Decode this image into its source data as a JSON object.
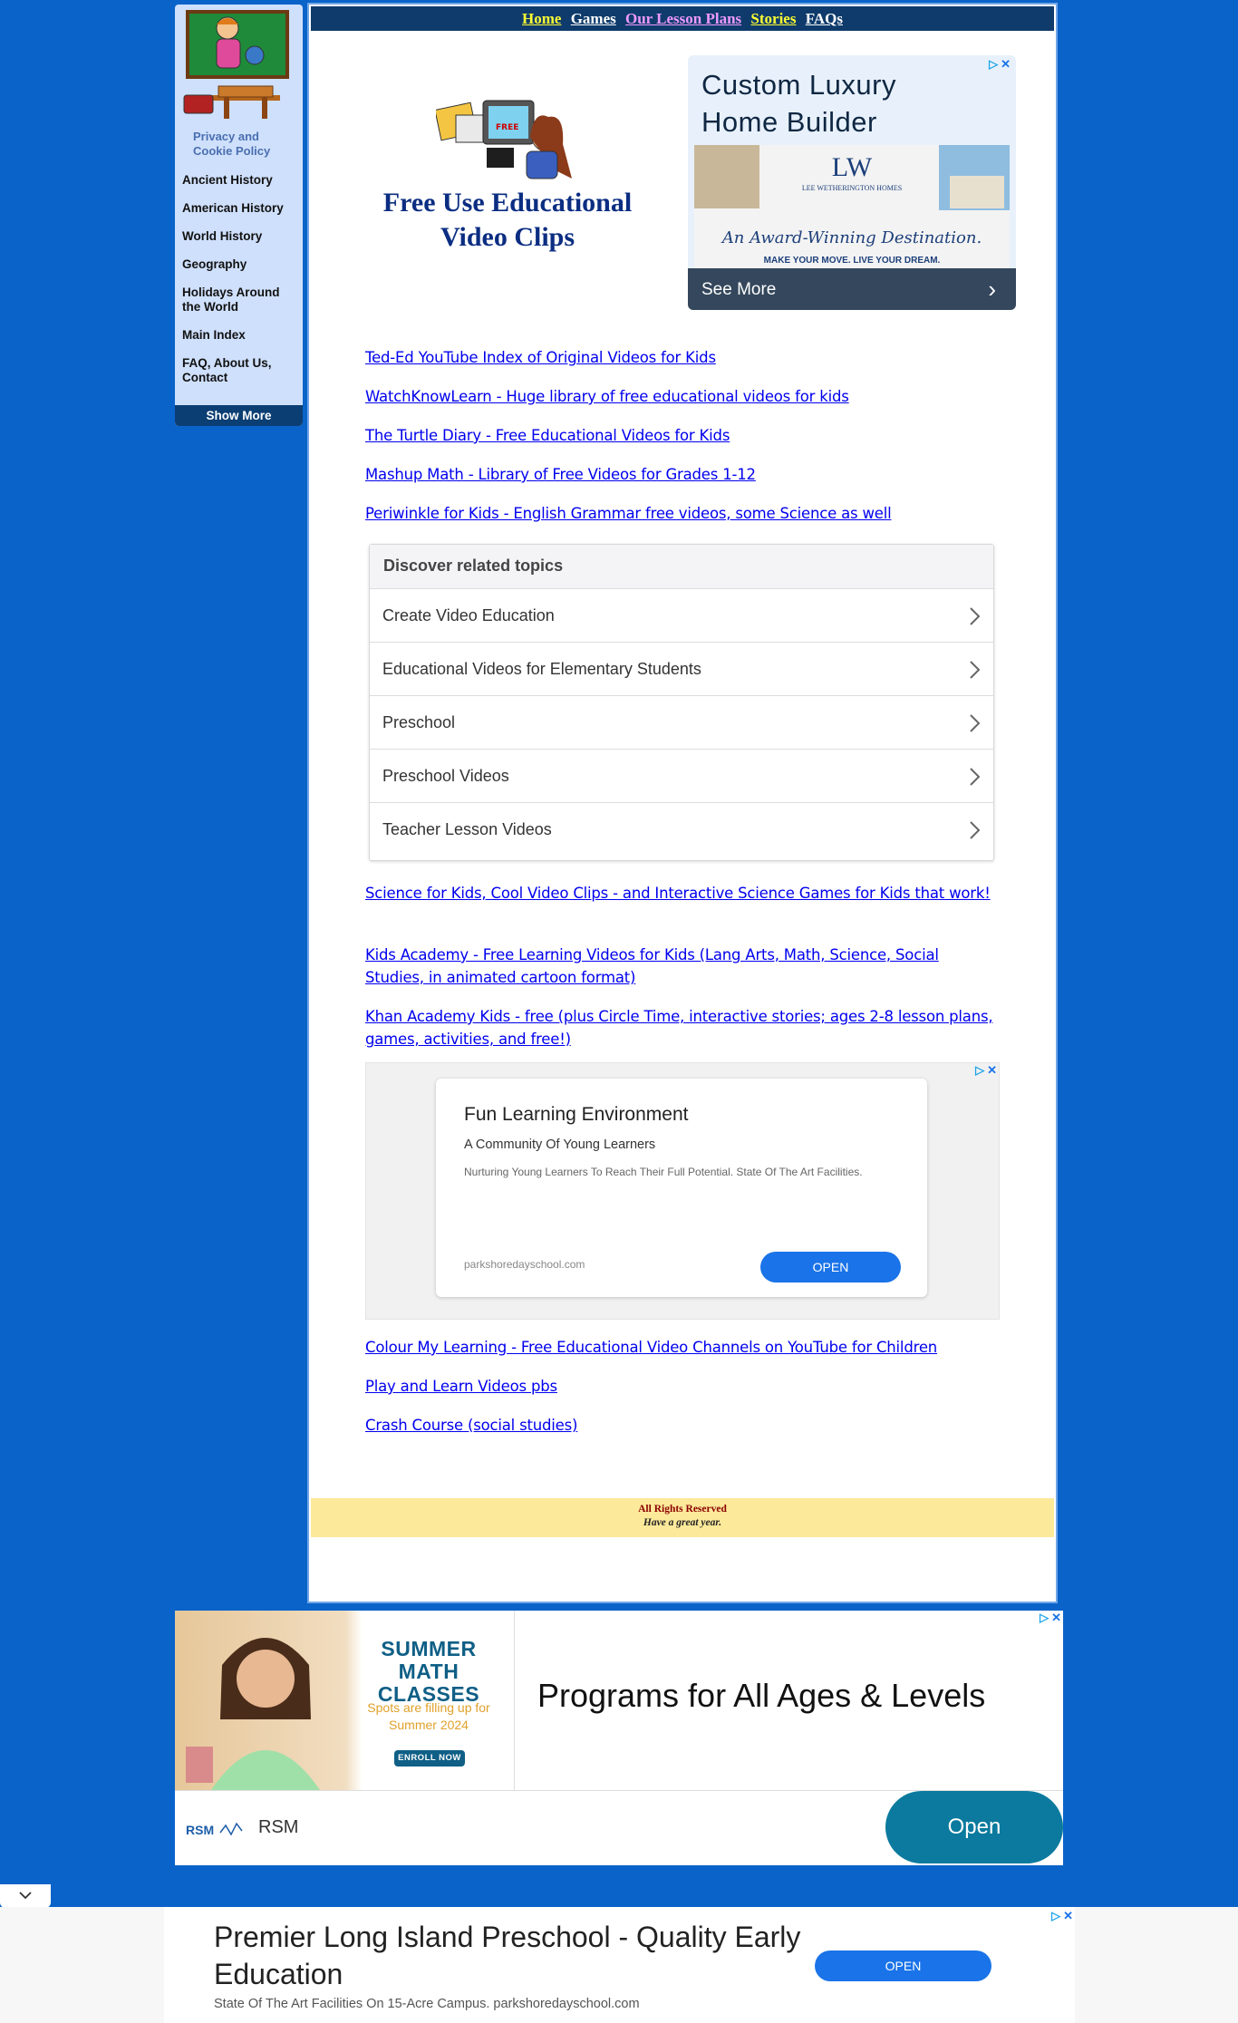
{
  "sidebar": {
    "privacy_label": "Privacy and Cookie Policy",
    "items": [
      {
        "label": "Ancient History"
      },
      {
        "label": "American History"
      },
      {
        "label": "World History"
      },
      {
        "label": "Geography"
      },
      {
        "label": "Holidays Around the World"
      },
      {
        "label": "Main Index"
      },
      {
        "label": "FAQ, About Us, Contact"
      }
    ],
    "show_more": "Show More"
  },
  "topnav": {
    "home": "Home",
    "games": "Games",
    "lesson_plans": "Our Lesson Plans",
    "stories": "Stories",
    "faqs": "FAQs"
  },
  "hero": {
    "title": "Free Use Educational Video Clips",
    "art_text": "FREE"
  },
  "ad_top": {
    "headline": "Custom Luxury Home Builder",
    "brand": "LEE WETHERINGTON HOMES",
    "script": "An Award-Winning Destination.",
    "slogan": "MAKE YOUR MOVE. LIVE YOUR DREAM.",
    "cta": "See More"
  },
  "links_a": [
    "Ted-Ed YouTube Index of Original Videos for Kids",
    "WatchKnowLearn - Huge library of free educational videos for kids",
    "The Turtle Diary - Free Educational Videos for Kids",
    "Mashup Math - Library of Free Videos for Grades 1-12",
    "Periwinkle for Kids - English Grammar free videos, some Science as well"
  ],
  "related": {
    "header": "Discover related topics",
    "topics": [
      "Create Video Education",
      "Educational Videos for Elementary Students",
      "Preschool",
      "Preschool Videos",
      "Teacher Lesson Videos"
    ]
  },
  "links_b": [
    "Science for Kids, Cool Video Clips - and Interactive Science Games for Kids that work!",
    "Kids Academy - Free Learning Videos for Kids (Lang Arts, Math, Science, Social Studies, in animated cartoon format)",
    "Khan Academy Kids - free (plus Circle Time, interactive stories; ages 2-8 lesson plans, games, activities, and free!)"
  ],
  "ad_mid": {
    "title": "Fun Learning Environment",
    "subtitle": "A Community Of Young Learners",
    "body": "Nurturing Young Learners To Reach Their Full Potential. State Of The Art Facilities.",
    "domain": "parkshoredayschool.com",
    "cta": "OPEN"
  },
  "links_c": [
    "Colour My Learning - Free Educational Video Channels on YouTube for Children",
    "Play and Learn Videos pbs",
    "Crash Course (social studies)"
  ],
  "footer": {
    "rights": "All Rights Reserved",
    "note": "Have a great year."
  },
  "ad_banner": {
    "promo_title": "SUMMER MATH CLASSES",
    "promo_sub": "Spots are filling up for Summer 2024",
    "promo_btn": "ENROLL NOW",
    "tagline": "Programs for All Ages & Levels",
    "brand": "RSM",
    "cta": "Open"
  },
  "ad_anchor": {
    "headline": "Premier Long Island Preschool - Quality Early Education",
    "sub": "State Of The Art Facilities On 15-Acre Campus. parkshoredayschool.com",
    "cta": "OPEN"
  },
  "colors": {
    "page_bg": "#0a63c9",
    "nav_bg": "#0e3b6b",
    "link": "#0000ee",
    "title": "#0b2d82",
    "footer_bg": "#fde99a",
    "ad_button": "#1a73e8"
  }
}
